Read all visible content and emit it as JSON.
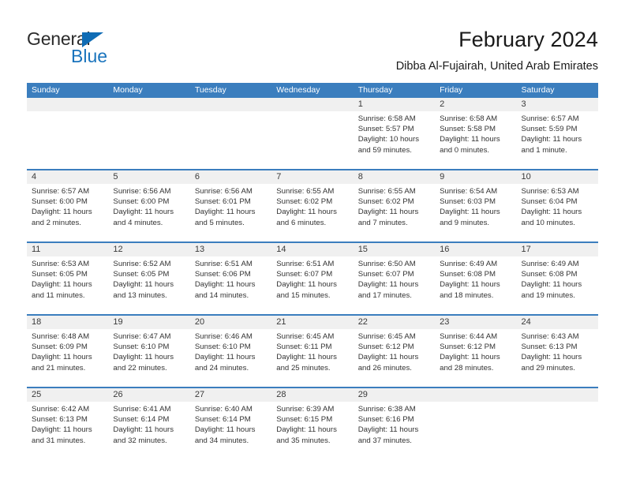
{
  "brand": {
    "name_part1": "General",
    "name_part2": "Blue",
    "triangle_color": "#0f6cb5",
    "blue_color": "#1a74bd"
  },
  "header": {
    "title": "February 2024",
    "location": "Dibba Al-Fujairah, United Arab Emirates",
    "header_bg": "#3b7ebe",
    "datebar_bg": "#f0f0f0"
  },
  "weekdays": [
    "Sunday",
    "Monday",
    "Tuesday",
    "Wednesday",
    "Thursday",
    "Friday",
    "Saturday"
  ],
  "weeks": [
    {
      "days": [
        {
          "num": "",
          "lines": []
        },
        {
          "num": "",
          "lines": []
        },
        {
          "num": "",
          "lines": []
        },
        {
          "num": "",
          "lines": []
        },
        {
          "num": "1",
          "lines": [
            "Sunrise: 6:58 AM",
            "Sunset: 5:57 PM",
            "Daylight: 10 hours",
            "and 59 minutes."
          ]
        },
        {
          "num": "2",
          "lines": [
            "Sunrise: 6:58 AM",
            "Sunset: 5:58 PM",
            "Daylight: 11 hours",
            "and 0 minutes."
          ]
        },
        {
          "num": "3",
          "lines": [
            "Sunrise: 6:57 AM",
            "Sunset: 5:59 PM",
            "Daylight: 11 hours",
            "and 1 minute."
          ]
        }
      ]
    },
    {
      "days": [
        {
          "num": "4",
          "lines": [
            "Sunrise: 6:57 AM",
            "Sunset: 6:00 PM",
            "Daylight: 11 hours",
            "and 2 minutes."
          ]
        },
        {
          "num": "5",
          "lines": [
            "Sunrise: 6:56 AM",
            "Sunset: 6:00 PM",
            "Daylight: 11 hours",
            "and 4 minutes."
          ]
        },
        {
          "num": "6",
          "lines": [
            "Sunrise: 6:56 AM",
            "Sunset: 6:01 PM",
            "Daylight: 11 hours",
            "and 5 minutes."
          ]
        },
        {
          "num": "7",
          "lines": [
            "Sunrise: 6:55 AM",
            "Sunset: 6:02 PM",
            "Daylight: 11 hours",
            "and 6 minutes."
          ]
        },
        {
          "num": "8",
          "lines": [
            "Sunrise: 6:55 AM",
            "Sunset: 6:02 PM",
            "Daylight: 11 hours",
            "and 7 minutes."
          ]
        },
        {
          "num": "9",
          "lines": [
            "Sunrise: 6:54 AM",
            "Sunset: 6:03 PM",
            "Daylight: 11 hours",
            "and 9 minutes."
          ]
        },
        {
          "num": "10",
          "lines": [
            "Sunrise: 6:53 AM",
            "Sunset: 6:04 PM",
            "Daylight: 11 hours",
            "and 10 minutes."
          ]
        }
      ]
    },
    {
      "days": [
        {
          "num": "11",
          "lines": [
            "Sunrise: 6:53 AM",
            "Sunset: 6:05 PM",
            "Daylight: 11 hours",
            "and 11 minutes."
          ]
        },
        {
          "num": "12",
          "lines": [
            "Sunrise: 6:52 AM",
            "Sunset: 6:05 PM",
            "Daylight: 11 hours",
            "and 13 minutes."
          ]
        },
        {
          "num": "13",
          "lines": [
            "Sunrise: 6:51 AM",
            "Sunset: 6:06 PM",
            "Daylight: 11 hours",
            "and 14 minutes."
          ]
        },
        {
          "num": "14",
          "lines": [
            "Sunrise: 6:51 AM",
            "Sunset: 6:07 PM",
            "Daylight: 11 hours",
            "and 15 minutes."
          ]
        },
        {
          "num": "15",
          "lines": [
            "Sunrise: 6:50 AM",
            "Sunset: 6:07 PM",
            "Daylight: 11 hours",
            "and 17 minutes."
          ]
        },
        {
          "num": "16",
          "lines": [
            "Sunrise: 6:49 AM",
            "Sunset: 6:08 PM",
            "Daylight: 11 hours",
            "and 18 minutes."
          ]
        },
        {
          "num": "17",
          "lines": [
            "Sunrise: 6:49 AM",
            "Sunset: 6:08 PM",
            "Daylight: 11 hours",
            "and 19 minutes."
          ]
        }
      ]
    },
    {
      "days": [
        {
          "num": "18",
          "lines": [
            "Sunrise: 6:48 AM",
            "Sunset: 6:09 PM",
            "Daylight: 11 hours",
            "and 21 minutes."
          ]
        },
        {
          "num": "19",
          "lines": [
            "Sunrise: 6:47 AM",
            "Sunset: 6:10 PM",
            "Daylight: 11 hours",
            "and 22 minutes."
          ]
        },
        {
          "num": "20",
          "lines": [
            "Sunrise: 6:46 AM",
            "Sunset: 6:10 PM",
            "Daylight: 11 hours",
            "and 24 minutes."
          ]
        },
        {
          "num": "21",
          "lines": [
            "Sunrise: 6:45 AM",
            "Sunset: 6:11 PM",
            "Daylight: 11 hours",
            "and 25 minutes."
          ]
        },
        {
          "num": "22",
          "lines": [
            "Sunrise: 6:45 AM",
            "Sunset: 6:12 PM",
            "Daylight: 11 hours",
            "and 26 minutes."
          ]
        },
        {
          "num": "23",
          "lines": [
            "Sunrise: 6:44 AM",
            "Sunset: 6:12 PM",
            "Daylight: 11 hours",
            "and 28 minutes."
          ]
        },
        {
          "num": "24",
          "lines": [
            "Sunrise: 6:43 AM",
            "Sunset: 6:13 PM",
            "Daylight: 11 hours",
            "and 29 minutes."
          ]
        }
      ]
    },
    {
      "days": [
        {
          "num": "25",
          "lines": [
            "Sunrise: 6:42 AM",
            "Sunset: 6:13 PM",
            "Daylight: 11 hours",
            "and 31 minutes."
          ]
        },
        {
          "num": "26",
          "lines": [
            "Sunrise: 6:41 AM",
            "Sunset: 6:14 PM",
            "Daylight: 11 hours",
            "and 32 minutes."
          ]
        },
        {
          "num": "27",
          "lines": [
            "Sunrise: 6:40 AM",
            "Sunset: 6:14 PM",
            "Daylight: 11 hours",
            "and 34 minutes."
          ]
        },
        {
          "num": "28",
          "lines": [
            "Sunrise: 6:39 AM",
            "Sunset: 6:15 PM",
            "Daylight: 11 hours",
            "and 35 minutes."
          ]
        },
        {
          "num": "29",
          "lines": [
            "Sunrise: 6:38 AM",
            "Sunset: 6:16 PM",
            "Daylight: 11 hours",
            "and 37 minutes."
          ]
        },
        {
          "num": "",
          "lines": []
        },
        {
          "num": "",
          "lines": []
        }
      ]
    }
  ]
}
